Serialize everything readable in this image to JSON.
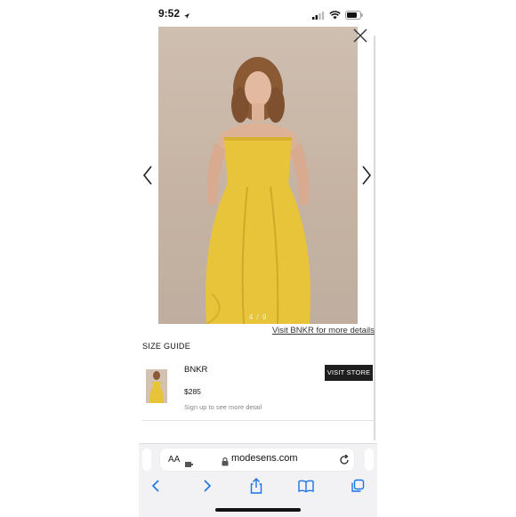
{
  "status_bar": {
    "time": "9:52"
  },
  "gallery": {
    "counter": "4 / 9",
    "visit_link": "Visit BNKR for more details"
  },
  "product": {
    "size_guide": "SIZE GUIDE",
    "brand": "BNKR",
    "price": "$285",
    "signup": "Sign up to see more detail",
    "visit_store": "VISIT STORE"
  },
  "browser": {
    "aa": "AA",
    "url": "modesens.com"
  },
  "icons": {
    "close": "close-icon",
    "prev": "chevron-left-icon",
    "next": "chevron-right-icon",
    "reload": "reload-icon",
    "lock": "lock-icon",
    "back": "back-icon",
    "forward": "forward-icon",
    "share": "share-icon",
    "bookmarks": "bookmarks-icon",
    "tabs": "tabs-icon"
  },
  "colors": {
    "dress": "#e8c43a",
    "button": "#1e1e1e",
    "link": "#007aff"
  }
}
